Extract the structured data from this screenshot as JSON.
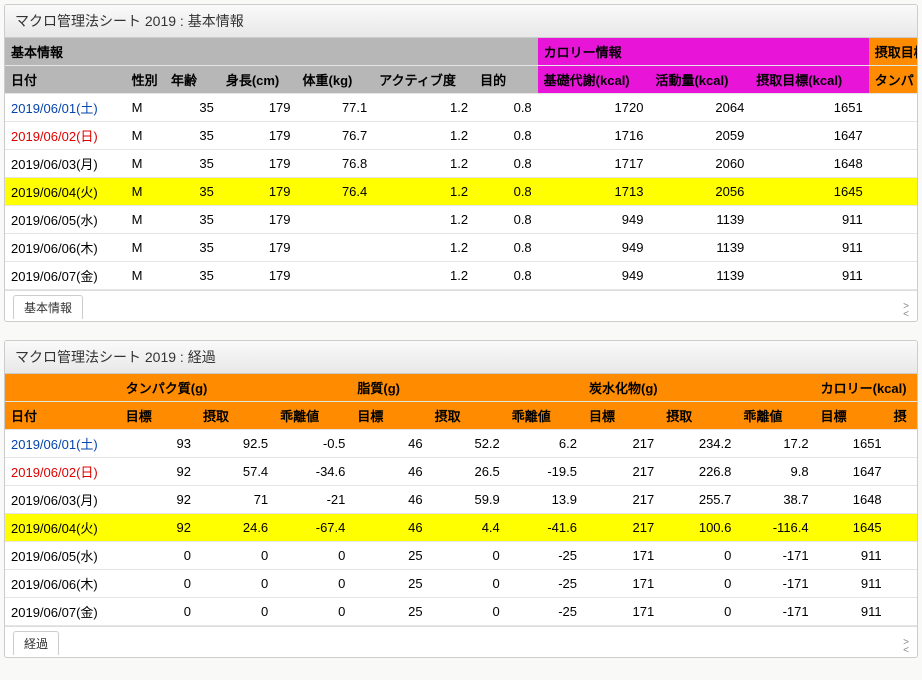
{
  "panel1": {
    "title": "マクロ管理法シート 2019 : 基本情報",
    "group_basic": "基本情報",
    "group_calorie": "カロリー情報",
    "group_intake": "摂取目標",
    "headers": {
      "date": "日付",
      "sex": "性別",
      "age": "年齢",
      "height": "身長(cm)",
      "weight": "体重(kg)",
      "activity": "アクティブ度",
      "purpose": "目的",
      "bmr": "基礎代謝(kcal)",
      "act_kcal": "活動量(kcal)",
      "goal": "摂取目標(kcal)",
      "protein": "タンパ"
    },
    "rows": [
      {
        "date": "2019/06/01(土)",
        "dclass": "date-link",
        "sex": "M",
        "age": "35",
        "height": "179",
        "weight": "77.1",
        "activity": "1.2",
        "purpose": "0.8",
        "bmr": "1720",
        "act_kcal": "2064",
        "goal": "1651"
      },
      {
        "date": "2019/06/02(日)",
        "dclass": "date-sun",
        "sex": "M",
        "age": "35",
        "height": "179",
        "weight": "76.7",
        "activity": "1.2",
        "purpose": "0.8",
        "bmr": "1716",
        "act_kcal": "2059",
        "goal": "1647"
      },
      {
        "date": "2019/06/03(月)",
        "dclass": "",
        "sex": "M",
        "age": "35",
        "height": "179",
        "weight": "76.8",
        "activity": "1.2",
        "purpose": "0.8",
        "bmr": "1717",
        "act_kcal": "2060",
        "goal": "1648"
      },
      {
        "date": "2019/06/04(火)",
        "dclass": "",
        "hl": true,
        "sex": "M",
        "age": "35",
        "height": "179",
        "weight": "76.4",
        "activity": "1.2",
        "purpose": "0.8",
        "bmr": "1713",
        "act_kcal": "2056",
        "goal": "1645"
      },
      {
        "date": "2019/06/05(水)",
        "dclass": "",
        "sex": "M",
        "age": "35",
        "height": "179",
        "weight": "",
        "activity": "1.2",
        "purpose": "0.8",
        "bmr": "949",
        "act_kcal": "1139",
        "goal": "911"
      },
      {
        "date": "2019/06/06(木)",
        "dclass": "",
        "sex": "M",
        "age": "35",
        "height": "179",
        "weight": "",
        "activity": "1.2",
        "purpose": "0.8",
        "bmr": "949",
        "act_kcal": "1139",
        "goal": "911"
      },
      {
        "date": "2019/06/07(金)",
        "dclass": "",
        "sex": "M",
        "age": "35",
        "height": "179",
        "weight": "",
        "activity": "1.2",
        "purpose": "0.8",
        "bmr": "949",
        "act_kcal": "1139",
        "goal": "911"
      }
    ],
    "tab": "基本情報"
  },
  "panel2": {
    "title": "マクロ管理法シート 2019 : 経過",
    "group_protein": "タンパク質(g)",
    "group_fat": "脂質(g)",
    "group_carb": "炭水化物(g)",
    "group_cal": "カロリー(kcal)",
    "headers": {
      "date": "日付",
      "target": "目標",
      "intake": "摂取",
      "diff": "乖離値"
    },
    "rows": [
      {
        "date": "2019/06/01(土)",
        "dclass": "date-link",
        "p_t": "93",
        "p_i": "92.5",
        "p_d": "-0.5",
        "f_t": "46",
        "f_i": "52.2",
        "f_d": "6.2",
        "c_t": "217",
        "c_i": "234.2",
        "c_d": "17.2",
        "cal": "1651"
      },
      {
        "date": "2019/06/02(日)",
        "dclass": "date-sun",
        "p_t": "92",
        "p_i": "57.4",
        "p_d": "-34.6",
        "f_t": "46",
        "f_i": "26.5",
        "f_d": "-19.5",
        "c_t": "217",
        "c_i": "226.8",
        "c_d": "9.8",
        "cal": "1647"
      },
      {
        "date": "2019/06/03(月)",
        "dclass": "",
        "p_t": "92",
        "p_i": "71",
        "p_d": "-21",
        "f_t": "46",
        "f_i": "59.9",
        "f_d": "13.9",
        "c_t": "217",
        "c_i": "255.7",
        "c_d": "38.7",
        "cal": "1648"
      },
      {
        "date": "2019/06/04(火)",
        "dclass": "",
        "hl": true,
        "p_t": "92",
        "p_i": "24.6",
        "p_d": "-67.4",
        "f_t": "46",
        "f_i": "4.4",
        "f_d": "-41.6",
        "c_t": "217",
        "c_i": "100.6",
        "c_d": "-116.4",
        "cal": "1645"
      },
      {
        "date": "2019/06/05(水)",
        "dclass": "",
        "p_t": "0",
        "p_i": "0",
        "p_d": "0",
        "f_t": "25",
        "f_i": "0",
        "f_d": "-25",
        "c_t": "171",
        "c_i": "0",
        "c_d": "-171",
        "cal": "911"
      },
      {
        "date": "2019/06/06(木)",
        "dclass": "",
        "p_t": "0",
        "p_i": "0",
        "p_d": "0",
        "f_t": "25",
        "f_i": "0",
        "f_d": "-25",
        "c_t": "171",
        "c_i": "0",
        "c_d": "-171",
        "cal": "911"
      },
      {
        "date": "2019/06/07(金)",
        "dclass": "",
        "p_t": "0",
        "p_i": "0",
        "p_d": "0",
        "f_t": "25",
        "f_i": "0",
        "f_d": "-25",
        "c_t": "171",
        "c_i": "0",
        "c_d": "-171",
        "cal": "911"
      }
    ],
    "tab": "経過",
    "intake_short": "摂"
  }
}
